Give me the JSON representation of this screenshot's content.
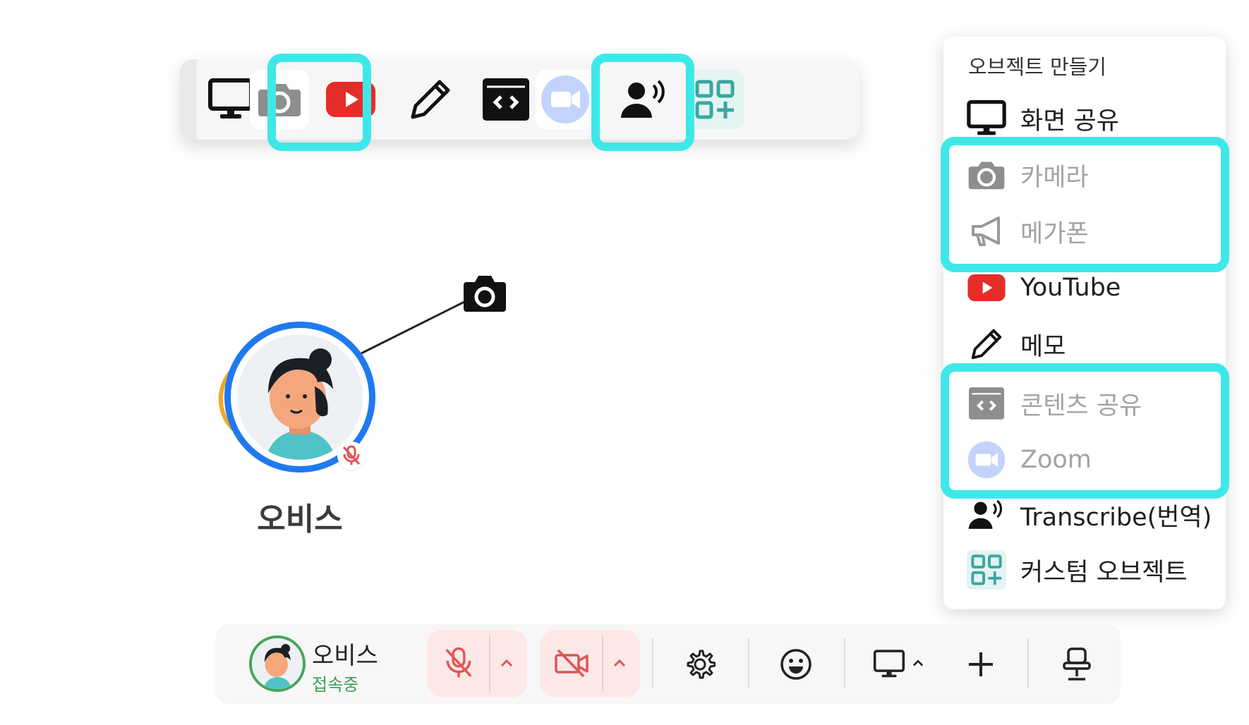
{
  "toolbar": {
    "items": [
      {
        "name": "screen-share",
        "icon": "monitor-icon"
      },
      {
        "name": "camera",
        "icon": "camera-icon",
        "highlighted": true
      },
      {
        "name": "youtube",
        "icon": "youtube-icon"
      },
      {
        "name": "memo",
        "icon": "pencil-icon"
      },
      {
        "name": "content-share",
        "icon": "code-window-icon"
      },
      {
        "name": "zoom",
        "icon": "zoom-icon",
        "highlighted": true
      },
      {
        "name": "transcribe",
        "icon": "speaking-person-icon"
      },
      {
        "name": "custom-object",
        "icon": "grid-plus-icon"
      }
    ]
  },
  "canvas": {
    "avatar_name": "오비스",
    "ring_color": "#1f7af0",
    "speaking_color": "#f5a623"
  },
  "menu": {
    "title": "오브젝트 만들기",
    "items": [
      {
        "label": "화면 공유",
        "icon": "monitor-icon",
        "disabled": false
      },
      {
        "label": "카메라",
        "icon": "camera-icon",
        "disabled": true
      },
      {
        "label": "메가폰",
        "icon": "megaphone-icon",
        "disabled": true
      },
      {
        "label": "YouTube",
        "icon": "youtube-icon",
        "disabled": false
      },
      {
        "label": "메모",
        "icon": "pencil-icon",
        "disabled": false
      },
      {
        "label": "콘텐츠 공유",
        "icon": "code-window-icon",
        "disabled": true
      },
      {
        "label": "Zoom",
        "icon": "zoom-icon",
        "disabled": true
      },
      {
        "label": "Transcribe(번역)",
        "icon": "speaking-person-icon",
        "disabled": false
      },
      {
        "label": "커스텀 오브젝트",
        "icon": "grid-plus-icon",
        "disabled": false
      }
    ]
  },
  "bottombar": {
    "user_name": "오비스",
    "user_status": "접속중",
    "mic": "muted",
    "camera": "off",
    "buttons": [
      "settings-icon",
      "emoji-icon",
      "screen-share-icon",
      "plus-icon",
      "chair-icon"
    ]
  },
  "colors": {
    "highlight": "#3fe8e8",
    "youtube": "#e52d27",
    "zoom": "#c3d3fb",
    "custom": "#3aa7a0",
    "muted_red": "#e05555",
    "online_green": "#3aa055"
  }
}
